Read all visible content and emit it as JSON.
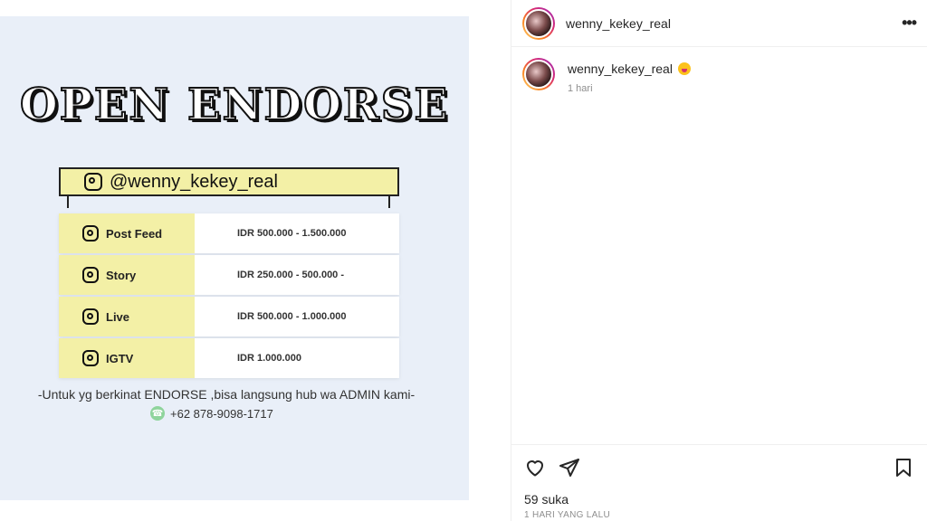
{
  "post": {
    "headline": "OPEN ENDORSE",
    "handle": "@wenny_kekey_real",
    "rates": [
      {
        "label": "Post Feed",
        "price": "IDR 500.000 - 1.500.000"
      },
      {
        "label": "Story",
        "price": "IDR 250.000 - 500.000 -"
      },
      {
        "label": "Live",
        "price": "IDR 500.000 - 1.000.000"
      },
      {
        "label": "IGTV",
        "price": "IDR 1.000.000"
      }
    ],
    "note": "-Untuk yg berkinat ENDORSE ,bisa langsung hub wa ADMIN kami-",
    "phone": "+62 878-9098-1717"
  },
  "header": {
    "username": "wenny_kekey_real",
    "more_icon": "more-horizontal-icon"
  },
  "caption": {
    "username": "wenny_kekey_real",
    "emoji": "grinning-face-tongue-emoji",
    "time": "1 hari"
  },
  "actions": {
    "icons": [
      "heart-icon",
      "send-icon",
      "bookmark-icon"
    ],
    "likes": "59 suka",
    "posted": "1 HARI YANG LALU"
  },
  "colors": {
    "highlight": "#f3f0a6",
    "image_bg": "#e9eff8",
    "text_secondary": "#8e8e8e",
    "divider": "#efefef"
  }
}
